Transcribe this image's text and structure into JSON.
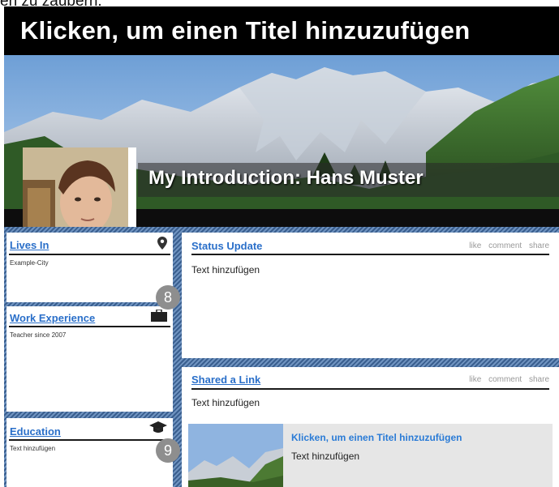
{
  "cut_text": "en zu zaubern.",
  "title": "Klicken, um einen Titel hinzuzufügen",
  "intro": "My Introduction: Hans Muster",
  "lives_in": {
    "title": "Lives In",
    "text": "Example-City",
    "icon": "map-pin-icon"
  },
  "work": {
    "title": "Work Experience",
    "text": "Teacher since 2007",
    "icon": "briefcase-icon"
  },
  "education": {
    "title": "Education",
    "text": "Text hinzufügen",
    "icon": "graduation-cap-icon"
  },
  "status": {
    "title": "Status Update",
    "text": "Text hinzufügen",
    "actions": [
      "like",
      "comment",
      "share"
    ]
  },
  "shared": {
    "title": "Shared a Link",
    "text": "Text hinzufügen",
    "actions": [
      "like",
      "comment",
      "share"
    ],
    "link_title": "Klicken, um einen Titel hinzuzufügen",
    "link_text": "Text hinzufügen"
  },
  "badges": [
    "8",
    "9"
  ]
}
